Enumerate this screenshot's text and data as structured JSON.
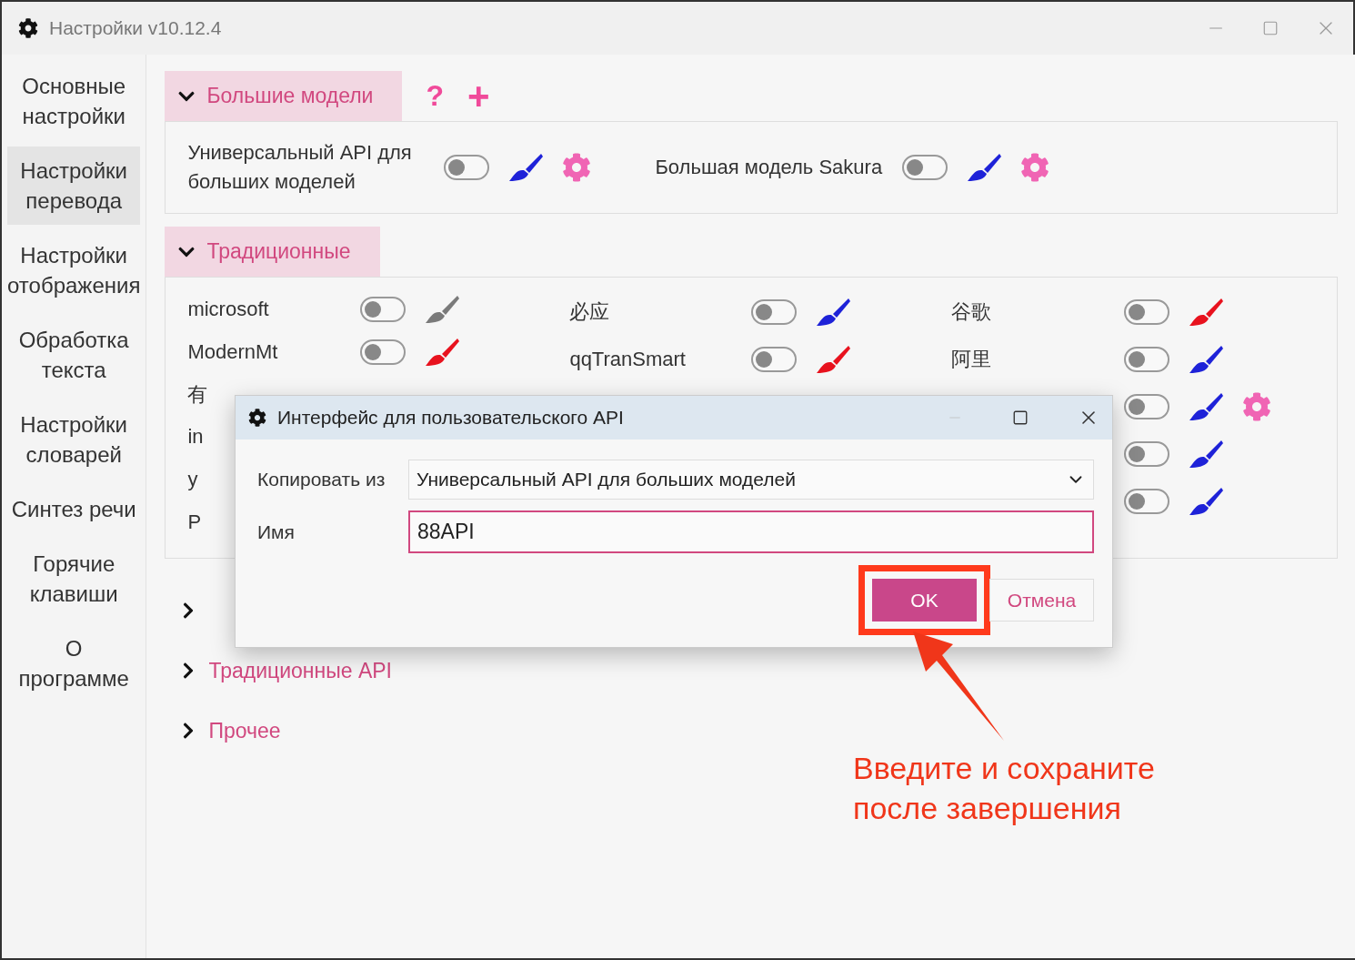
{
  "window": {
    "title": "Настройки v10.12.4"
  },
  "sidebar": {
    "items": [
      {
        "label": "Основные настройки",
        "selected": false
      },
      {
        "label": "Настройки перевода",
        "selected": true
      },
      {
        "label": "Настройки отображения",
        "selected": false
      },
      {
        "label": "Обработка текста",
        "selected": false
      },
      {
        "label": "Настройки словарей",
        "selected": false
      },
      {
        "label": "Синтез речи",
        "selected": false
      },
      {
        "label": "Горячие клавиши",
        "selected": false
      },
      {
        "label": "О программе",
        "selected": false
      }
    ]
  },
  "sections": [
    {
      "title": "Большие модели",
      "expanded": true,
      "actions": [
        {
          "kind": "help",
          "label": "?"
        },
        {
          "kind": "add",
          "label": "+"
        }
      ],
      "items": [
        {
          "label": "Универсальный API для больших моделей",
          "on": false,
          "color": "#1e22d8",
          "kind": "with-settings"
        },
        {
          "label": "Большая модель Sakura",
          "on": false,
          "color": "#1e22d8",
          "kind": "with-settings"
        }
      ]
    },
    {
      "title": "Традиционные",
      "expanded": true,
      "columns": [
        [
          {
            "label": "microsoft",
            "on": false,
            "color": "#7a7a7a",
            "kind": "plain"
          },
          {
            "label": "ModernMt",
            "on": false,
            "color": "#e8121e",
            "kind": "plain"
          },
          {
            "label": "有",
            "kind": "covered"
          },
          {
            "label": "in",
            "kind": "covered"
          },
          {
            "label": "y",
            "kind": "covered"
          },
          {
            "label": "P",
            "kind": "covered"
          }
        ],
        [
          {
            "label": "必应",
            "on": false,
            "color": "#1e22d8",
            "kind": "plain"
          },
          {
            "label": "qqTranSmart",
            "on": false,
            "color": "#e8121e",
            "kind": "plain"
          }
        ],
        [
          {
            "label": "谷歌",
            "on": false,
            "color": "#e8121e",
            "kind": "plain"
          },
          {
            "label": "阿里",
            "on": false,
            "color": "#1e22d8",
            "kind": "plain"
          },
          {
            "on": false,
            "color": "#1e22d8",
            "kind": "with-settings"
          },
          {
            "on": false,
            "color": "#1e22d8",
            "kind": "plain"
          },
          {
            "on": false,
            "color": "#1e22d8",
            "kind": "plain"
          }
        ]
      ]
    },
    {
      "expanded": false
    },
    {
      "title": "Традиционные API",
      "expanded": false
    },
    {
      "title": "Прочее",
      "expanded": false
    }
  ],
  "dialog": {
    "title": "Интерфейс для пользовательского API",
    "copy_from": {
      "label": "Копировать из",
      "value": "Универсальный API для больших моделей"
    },
    "name": {
      "label": "Имя",
      "value": "88API"
    },
    "buttons": [
      {
        "kind": "primary",
        "label": "OK",
        "highlighted": true
      },
      {
        "kind": "secondary",
        "label": "Отмена",
        "highlighted": false
      }
    ]
  },
  "annotation": {
    "text": "Введите и сохраните\nпосле завершения"
  }
}
